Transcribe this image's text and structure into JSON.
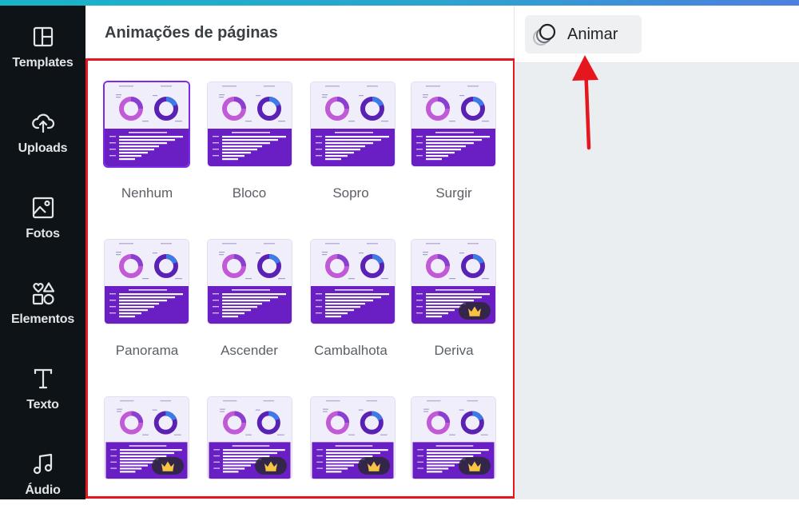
{
  "sidebar": {
    "items": [
      {
        "label": "Templates",
        "icon": "layout-icon"
      },
      {
        "label": "Uploads",
        "icon": "cloud-upload-icon"
      },
      {
        "label": "Fotos",
        "icon": "image-icon"
      },
      {
        "label": "Elementos",
        "icon": "shapes-icon"
      },
      {
        "label": "Texto",
        "icon": "text-icon"
      },
      {
        "label": "Áudio",
        "icon": "music-note-icon"
      }
    ]
  },
  "panel": {
    "title": "Animações de páginas",
    "animations": [
      {
        "label": "Nenhum",
        "premium": false,
        "selected": true
      },
      {
        "label": "Bloco",
        "premium": false,
        "selected": false
      },
      {
        "label": "Sopro",
        "premium": false,
        "selected": false
      },
      {
        "label": "Surgir",
        "premium": false,
        "selected": false
      },
      {
        "label": "Panorama",
        "premium": false,
        "selected": false
      },
      {
        "label": "Ascender",
        "premium": false,
        "selected": false
      },
      {
        "label": "Cambalhota",
        "premium": false,
        "selected": false
      },
      {
        "label": "Deriva",
        "premium": true,
        "selected": false
      },
      {
        "label": "",
        "premium": true,
        "selected": false
      },
      {
        "label": "",
        "premium": true,
        "selected": false
      },
      {
        "label": "",
        "premium": true,
        "selected": false
      },
      {
        "label": "",
        "premium": true,
        "selected": false
      }
    ]
  },
  "toolbar": {
    "animate_label": "Animar"
  },
  "colors": {
    "accent_purple": "#6a1fc4",
    "highlight_red": "#e5161d",
    "sidebar_bg": "#0e1318",
    "crown_gold": "#f6c343"
  }
}
